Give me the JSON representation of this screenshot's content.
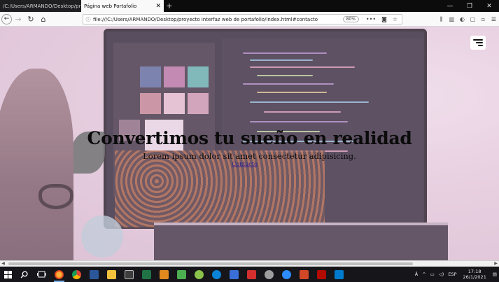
{
  "browser": {
    "tabs": [
      {
        "label": "/C:/Users/ARMANDO/Desktop/pr",
        "active": false
      },
      {
        "label": "Página web Portafolio",
        "active": true
      }
    ],
    "url": "file:///C:/Users/ARMANDO/Desktop/proyecto interfaz web de portafolio/index.html#contacto",
    "zoom": "80%"
  },
  "page": {
    "title": "Convertimos tu sueño en realidad",
    "subtitle": "Lorem ipsum dolor sit amet consectetur adipisicing.",
    "link": "Contacto"
  },
  "taskbar": {
    "language": "ESP",
    "time": "17:18",
    "date": "26/1/2021"
  }
}
